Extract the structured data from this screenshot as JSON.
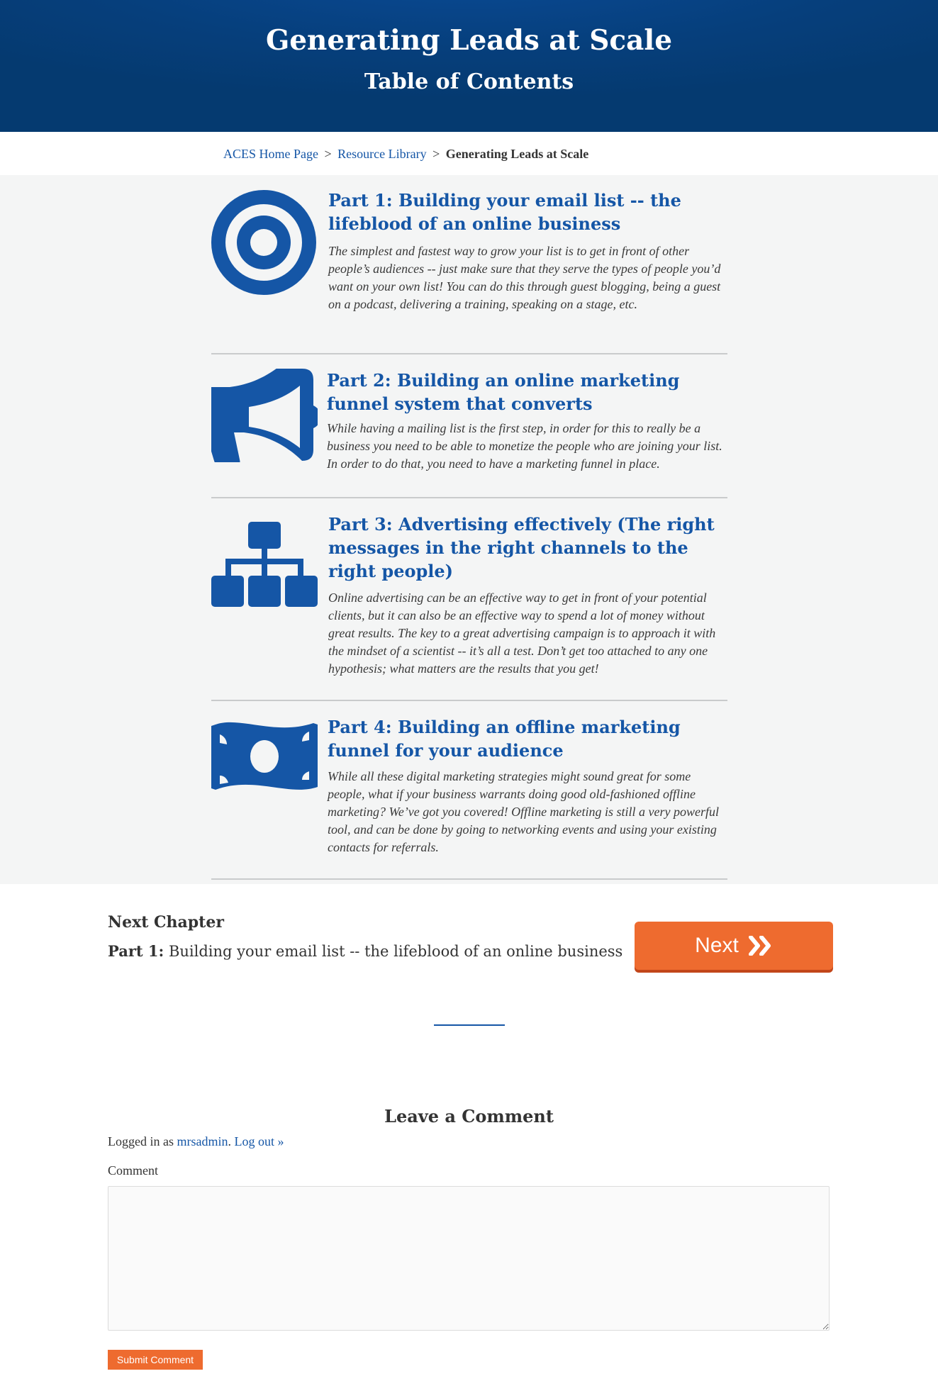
{
  "header": {
    "title": "Generating Leads at Scale",
    "subtitle": "Table of Contents"
  },
  "breadcrumb": {
    "home": "ACES Home Page",
    "library": "Resource Library",
    "current": "Generating Leads at Scale",
    "separator": ">"
  },
  "toc": {
    "items": [
      {
        "icon": "target-icon",
        "title": "Part 1: Building your email list -- the lifeblood of an online business",
        "description": "The simplest and fastest way to grow your list is to get in front of other people’s audiences -- just make sure that they serve the types of people you’d want on your own list! You can do this through guest blogging, being a guest on a podcast, delivering a training, speaking on a stage, etc."
      },
      {
        "icon": "megaphone-icon",
        "title": "Part 2: Building an online marketing funnel system that converts",
        "description": "While having a mailing list is the first step, in order for this to really be a business you need to be able to monetize the people who are joining your list. In order to do that, you need to have a marketing funnel in place."
      },
      {
        "icon": "sitemap-icon",
        "title": "Part 3: Advertising effectively (The right messages in the right channels to the right people)",
        "description": "Online advertising can be an effective way to get in front of your potential clients, but it can also be an effective way to spend a lot of money without great results. The key to a great advertising campaign is to approach it with the mindset of a scientist -- it’s all a test. Don’t get too attached to any one hypothesis; what matters are the results that you get!"
      },
      {
        "icon": "money-bill-icon",
        "title": "Part 4: Building an offline marketing funnel for your audience",
        "description": "While all these digital marketing strategies might sound great for some people, what if your business warrants doing good old-fashioned offline marketing? We’ve got you covered! Offline marketing is still a very powerful tool, and can be done by going to networking events and using your existing contacts for referrals."
      }
    ]
  },
  "next_chapter": {
    "heading": "Next Chapter",
    "part_label": "Part 1:",
    "part_text": "Building your email list -- the lifeblood of an online business",
    "button_label": "Next",
    "button_icon": "double-chevron-right-icon"
  },
  "comments": {
    "heading": "Leave a Comment",
    "logged_prefix": "Logged in as",
    "username": "mrsadmin",
    "logout": "Log out »",
    "comment_label": "Comment",
    "comment_value": "",
    "submit_label": "Submit Comment"
  },
  "colors": {
    "brand_blue": "#1556a6",
    "header_bg": "#053b74",
    "accent_orange": "#ee6b2f",
    "toc_bg": "#f4f5f5"
  }
}
